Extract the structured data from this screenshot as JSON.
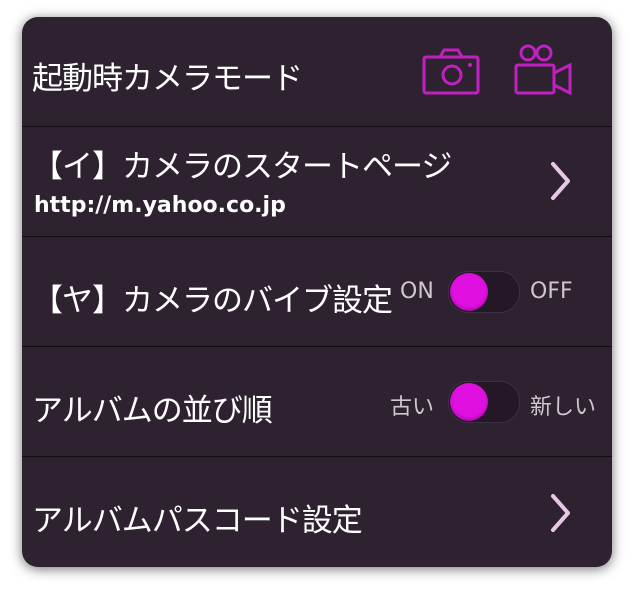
{
  "accent_color": "#c020c0",
  "toggle_color": "#e010e0",
  "settings": {
    "startup_mode": {
      "label": "起動時カメラモード",
      "options": [
        "camera-icon",
        "video-camera-icon"
      ]
    },
    "start_page": {
      "label": "【イ】カメラのスタートページ",
      "value": "http://m.yahoo.co.jp",
      "icon": "chevron-right-icon"
    },
    "vibration": {
      "label": "【ヤ】カメラのバイブ設定",
      "on_label": "ON",
      "off_label": "OFF",
      "state": "on"
    },
    "album_order": {
      "label": "アルバムの並び順",
      "left_label": "古い",
      "right_label": "新しい",
      "state": "古い"
    },
    "album_passcode": {
      "label": "アルバムパスコード設定",
      "icon": "chevron-right-icon"
    }
  }
}
